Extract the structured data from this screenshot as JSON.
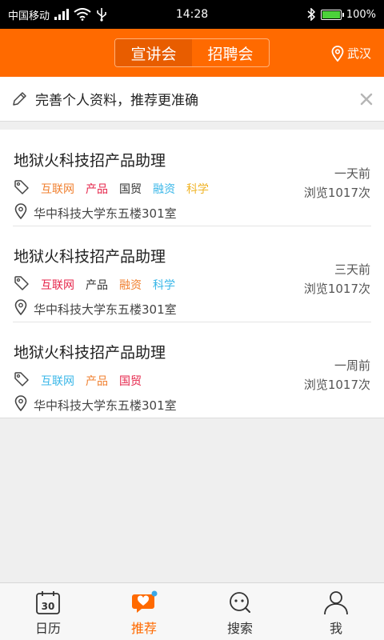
{
  "status_bar": {
    "carrier": "中国移动",
    "time": "14:28",
    "battery": "100%"
  },
  "header": {
    "segments": [
      {
        "label": "宣讲会",
        "active": true
      },
      {
        "label": "招聘会",
        "active": false
      }
    ],
    "location": "武汉"
  },
  "tip": {
    "text": "完善个人资料，推荐更准确"
  },
  "listings": [
    {
      "title": "地狱火科技招产品助理",
      "tags": [
        {
          "text": "互联网",
          "color": "#f08030"
        },
        {
          "text": "产品",
          "color": "#e6264b"
        },
        {
          "text": "国贸",
          "color": "#333333"
        },
        {
          "text": "融资",
          "color": "#3ab7e8"
        },
        {
          "text": "科学",
          "color": "#f0b428"
        }
      ],
      "address": "华中科技大学东五楼301室",
      "time": "一天前",
      "views": "浏览1017次"
    },
    {
      "title": "地狱火科技招产品助理",
      "tags": [
        {
          "text": "互联网",
          "color": "#e6264b"
        },
        {
          "text": "产品",
          "color": "#333333"
        },
        {
          "text": "融资",
          "color": "#f08030"
        },
        {
          "text": "科学",
          "color": "#3ab7e8"
        }
      ],
      "address": "华中科技大学东五楼301室",
      "time": "三天前",
      "views": "浏览1017次"
    },
    {
      "title": "地狱火科技招产品助理",
      "tags": [
        {
          "text": "互联网",
          "color": "#3ab7e8"
        },
        {
          "text": "产品",
          "color": "#f08030"
        },
        {
          "text": "国贸",
          "color": "#e6264b"
        }
      ],
      "address": "华中科技大学东五楼301室",
      "time": "一周前",
      "views": "浏览1017次"
    }
  ],
  "tabbar": {
    "tabs": [
      {
        "label": "日历",
        "icon": "calendar-icon",
        "active": false
      },
      {
        "label": "推荐",
        "icon": "heart-chat-icon",
        "active": true
      },
      {
        "label": "搜索",
        "icon": "search-bubble-icon",
        "active": false
      },
      {
        "label": "我",
        "icon": "person-icon",
        "active": false
      }
    ],
    "calendar_day": "30"
  },
  "colors": {
    "brand": "#ff6a00",
    "brand_dark": "#e85d00"
  }
}
